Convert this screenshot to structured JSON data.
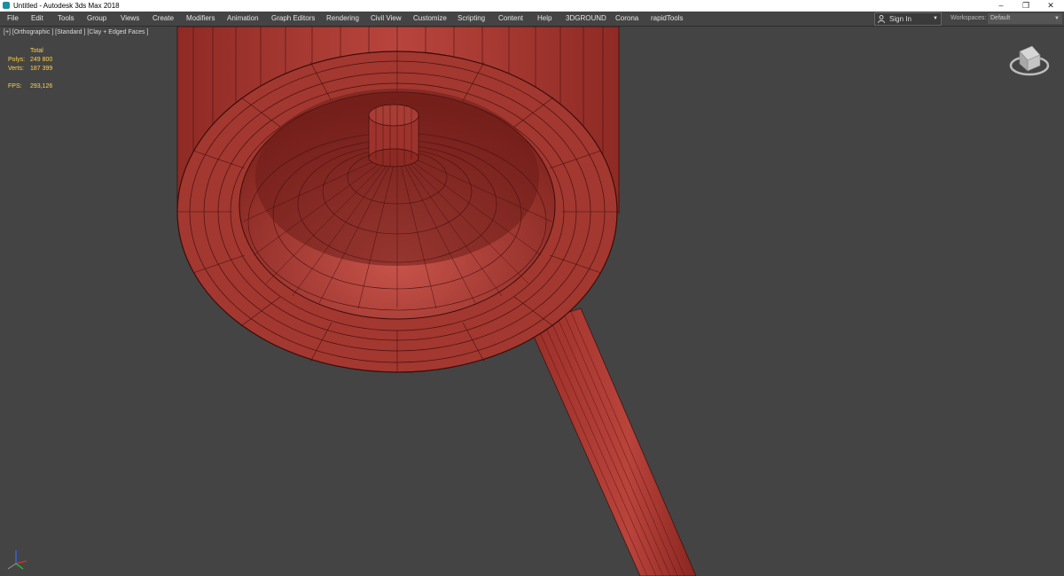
{
  "window": {
    "title": "Untitled - Autodesk 3ds Max 2018",
    "controls": {
      "minimize": "–",
      "restore": "❐",
      "close": "✕"
    }
  },
  "menu": [
    "File",
    "Edit",
    "Tools",
    "Group",
    "Views",
    "Create",
    "Modifiers",
    "Animation",
    "Graph Editors",
    "Rendering",
    "Civil View",
    "Customize",
    "Scripting",
    "Content",
    "Help",
    "3DGROUND",
    "Corona",
    "rapidTools"
  ],
  "account": {
    "sign_in": "Sign In",
    "caret": "▼"
  },
  "workspaces": {
    "label": "Workspaces:",
    "value": "Default",
    "caret": "▼"
  },
  "viewport": {
    "label": "[+] [Orthographic ] [Standard ] [Clay + Edged Faces ]",
    "stats": {
      "header": "Total",
      "polys_label": "Polys:",
      "polys": "249 800",
      "verts_label": "Verts:",
      "verts": "187 399",
      "fps_label": "FPS:",
      "fps": "293,126"
    }
  },
  "colors": {
    "ui_bg": "#444444",
    "stats_text": "#ffd24a",
    "mesh": "#b5423b",
    "mesh_dark": "#7c1f1b",
    "wire": "#3c0c0a"
  },
  "icons": [
    "app-icon",
    "person-icon",
    "viewcube-icon",
    "axis-tripod-icon",
    "minimize-icon",
    "restore-icon",
    "close-icon"
  ]
}
